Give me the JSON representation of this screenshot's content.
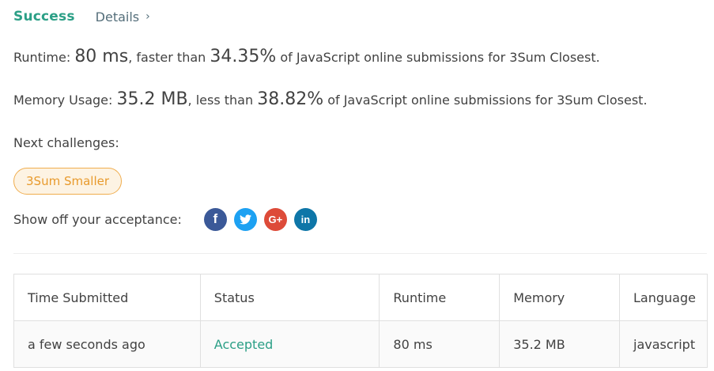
{
  "header": {
    "status": "Success",
    "details_label": "Details",
    "details_chevron": "›"
  },
  "runtime": {
    "label": "Runtime: ",
    "value": "80 ms",
    "middle": ", faster than ",
    "percent": "34.35%",
    "suffix": " of JavaScript online submissions for 3Sum Closest."
  },
  "memory": {
    "label": "Memory Usage: ",
    "value": "35.2 MB",
    "middle": ", less than ",
    "percent": "38.82%",
    "suffix": " of JavaScript online submissions for 3Sum Closest."
  },
  "next": {
    "label": "Next challenges:",
    "challenge": "3Sum Smaller"
  },
  "share": {
    "label": "Show off your acceptance:",
    "icons": [
      "facebook-icon",
      "twitter-icon",
      "google-plus-icon",
      "linkedin-icon"
    ],
    "facebook_glyph": "f",
    "googleplus_glyph": "G+",
    "linkedin_glyph": "in"
  },
  "table": {
    "headers": [
      "Time Submitted",
      "Status",
      "Runtime",
      "Memory",
      "Language"
    ],
    "row": {
      "time": "a few seconds ago",
      "status": "Accepted",
      "runtime": "80 ms",
      "memory": "35.2 MB",
      "language": "javascript"
    }
  },
  "colors": {
    "success": "#2b9f86",
    "chip_border": "#f0ad4e",
    "chip_text": "#e89a2c",
    "facebook": "#3b5998",
    "twitter": "#1da1f2",
    "google_plus": "#dd4b39",
    "linkedin": "#0e76a8"
  }
}
